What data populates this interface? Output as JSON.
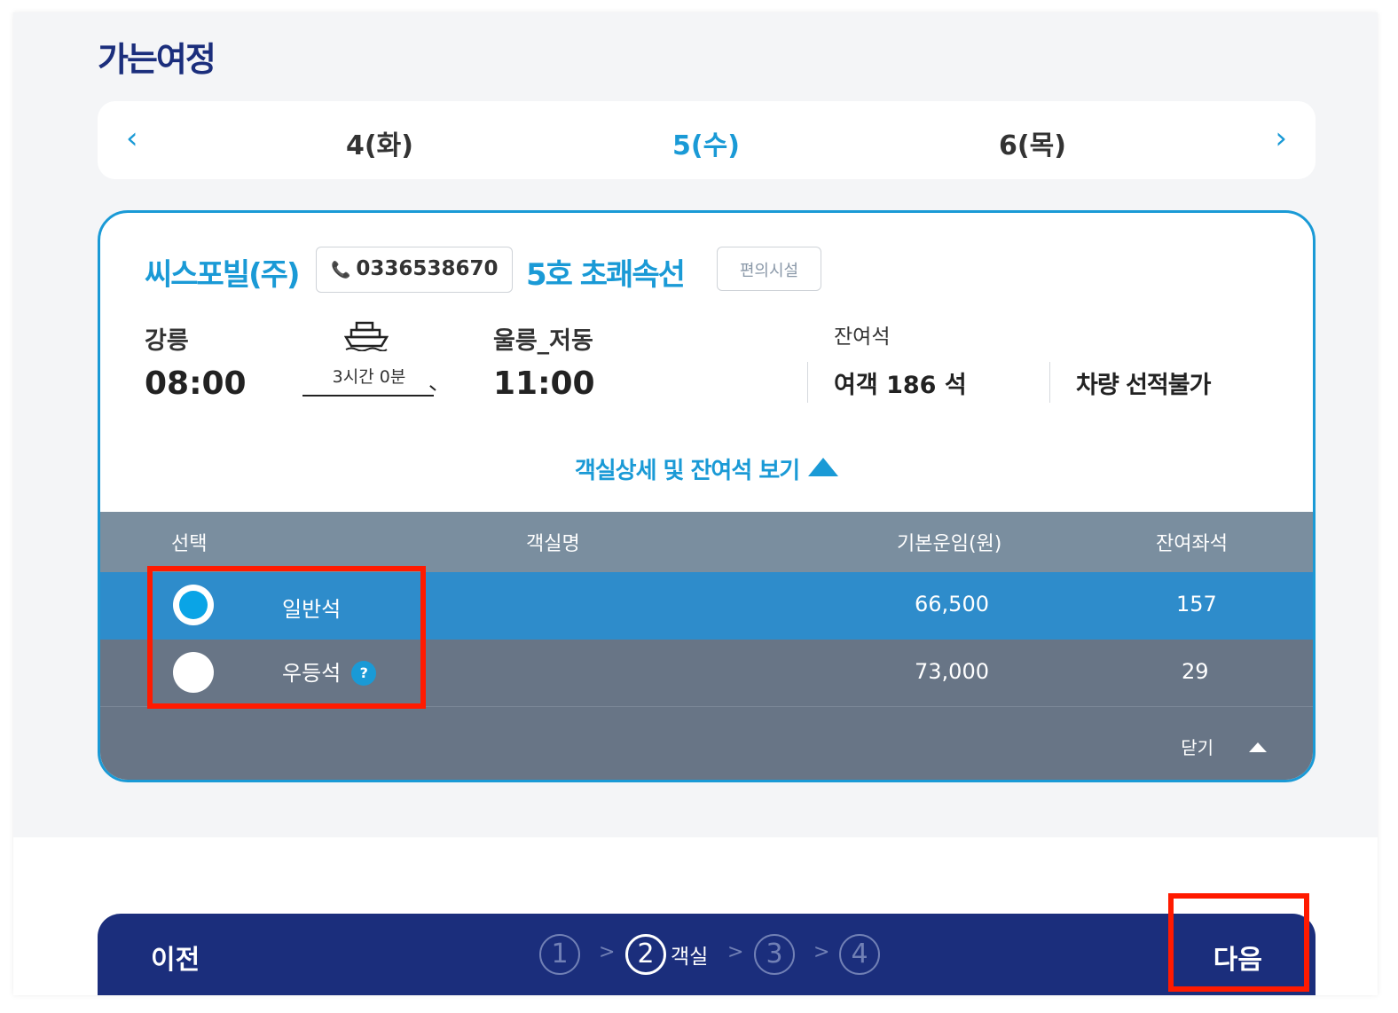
{
  "section_title": "가는여정",
  "dates": {
    "prev_icon": "chevron-left-icon",
    "next_icon": "chevron-right-icon",
    "items": [
      "4(화)",
      "5(수)",
      "6(목)"
    ],
    "selected": "5(수)"
  },
  "voyage": {
    "company": "씨스포빌(주)",
    "phone": "0336538670",
    "ship": "5호 초쾌속선",
    "facility_label": "편의시설",
    "departure_port": "강릉",
    "departure_time": "08:00",
    "arrival_port": "울릉_저동",
    "arrival_time": "11:00",
    "duration": "3시간 0분",
    "remain_label": "잔여석",
    "remain_passenger": "여객 186 석",
    "vehicle_status": "차량 선적불가",
    "toggle_label": "객실상세 및 잔여석 보기"
  },
  "cabin_table": {
    "headers": [
      "선택",
      "객실명",
      "기본운임(원)",
      "잔여좌석"
    ],
    "rows": [
      {
        "name": "일반석",
        "fare": "66,500",
        "seats": "157",
        "selected": true
      },
      {
        "name": "우등석",
        "fare": "73,000",
        "seats": "29",
        "selected": false,
        "help": "?"
      }
    ],
    "close_label": "닫기"
  },
  "footer": {
    "prev_label": "이전",
    "next_label": "다음",
    "steps": [
      "1",
      "2",
      "3",
      "4"
    ],
    "active_step_label": "객실",
    "step_separator": ">"
  },
  "colors": {
    "accent": "#1a9ad6",
    "navy": "#1b2e7c",
    "selected_row": "#2e8ccb",
    "table_bg": "#687586",
    "highlight": "#ff1a00"
  }
}
